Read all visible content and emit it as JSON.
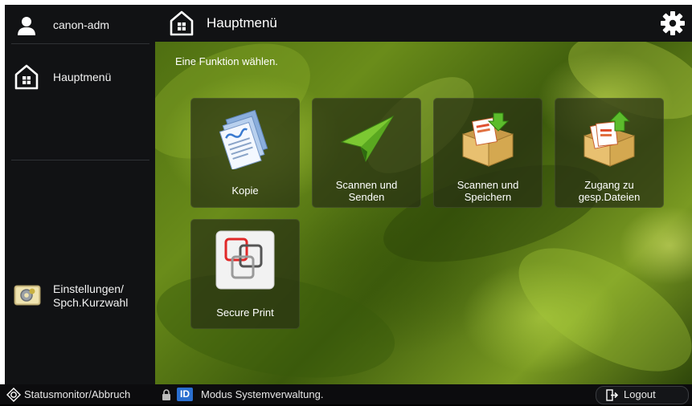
{
  "user": {
    "name": "canon-adm"
  },
  "sidebar": {
    "main_menu_label": "Hauptmenü",
    "settings_label_line1": "Einstellungen/",
    "settings_label_line2": "Spch.Kurzwahl"
  },
  "header": {
    "title": "Hauptmenü"
  },
  "main": {
    "prompt": "Eine Funktion wählen.",
    "tiles": [
      {
        "line1": "Kopie",
        "line2": ""
      },
      {
        "line1": "Scannen und",
        "line2": "Senden"
      },
      {
        "line1": "Scannen und",
        "line2": "Speichern"
      },
      {
        "line1": "Zugang zu",
        "line2": "gesp.Dateien"
      },
      {
        "line1": "Secure Print",
        "line2": ""
      }
    ]
  },
  "statusbar": {
    "status_monitor": "Statusmonitor/Abbruch",
    "mode_text": "Modus Systemverwaltung.",
    "logout": "Logout"
  },
  "icons": {
    "user": "user-icon",
    "home": "home-icon",
    "settings": "settings-icon",
    "gear": "gear-icon",
    "status": "status-monitor-icon",
    "lock": "lock-icon",
    "id": "id-icon",
    "logout": "logout-icon"
  }
}
